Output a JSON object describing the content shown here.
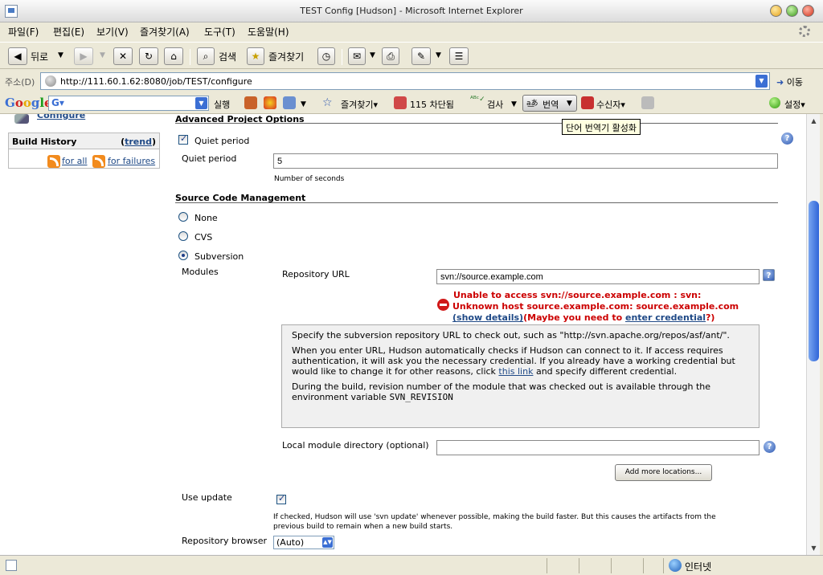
{
  "window": {
    "title": "TEST Config [Hudson] - Microsoft Internet Explorer"
  },
  "menu": [
    "파일(F)",
    "편집(E)",
    "보기(V)",
    "즐겨찾기(A)",
    "도구(T)",
    "도움말(H)"
  ],
  "toolbar": {
    "back": "뒤로",
    "search": "검색",
    "favorites": "즐겨찾기"
  },
  "address": {
    "label": "주소(D)",
    "url": "http://111.60.1.62:8080/job/TEST/configure",
    "go": "이동"
  },
  "google_toolbar": {
    "logo": "Google",
    "run": "실행",
    "favorites": "즐겨찾기",
    "blocked": "115 차단됨",
    "check": "검사",
    "translate": "번역",
    "recipient": "수신자",
    "settings": "설정"
  },
  "tooltip": "단어 번역기 활성화",
  "sidebar": {
    "configure": "Configure",
    "build_history": "Build History",
    "trend": "trend",
    "for_all": "for all",
    "for_failures": "for failures"
  },
  "advanced": {
    "title": "Advanced Project Options",
    "quiet_checkbox_label": "Quiet period",
    "quiet_label": "Quiet period",
    "quiet_value": "5",
    "quiet_hint": "Number of seconds"
  },
  "scm": {
    "title": "Source Code Management",
    "options": [
      "None",
      "CVS",
      "Subversion"
    ],
    "modules_label": "Modules",
    "repo_url_label": "Repository URL",
    "repo_url_value": "svn://source.example.com",
    "error_line1": "Unable to access svn://source.example.com : svn:",
    "error_line2": "Unknown host source.example.com: source.example.com",
    "error_show_details": "(show details)",
    "error_maybe_prefix": "(Maybe you need to ",
    "error_enter_credential": "enter credential",
    "error_maybe_suffix": "?)",
    "help_p1": "Specify the subversion repository URL to check out, such as \"http://svn.apache.org/repos/asf/ant/\".",
    "help_p2_prefix": "When you enter URL, Hudson automatically checks if Hudson can connect to it. If access requires authentication, it will ask you the necessary credential. If you already have a working credential but would like to change it for other reasons, click ",
    "help_p2_link": "this link",
    "help_p2_suffix": " and specify different credential.",
    "help_p3": "During the build, revision number of the module that was checked out is available through the environment variable ",
    "help_p3_var": "SVN_REVISION",
    "local_dir_label": "Local module directory (optional)",
    "local_dir_value": "",
    "add_more_button": "Add more locations...",
    "use_update_label": "Use update",
    "use_update_hint_line1": "If checked, Hudson will use 'svn update' whenever possible, making the build faster. But this causes the artifacts from the",
    "use_update_hint_line2": "previous build to remain when a new build starts.",
    "repo_browser_label": "Repository browser",
    "repo_browser_value": "(Auto)"
  },
  "status": {
    "zone": "인터넷"
  }
}
